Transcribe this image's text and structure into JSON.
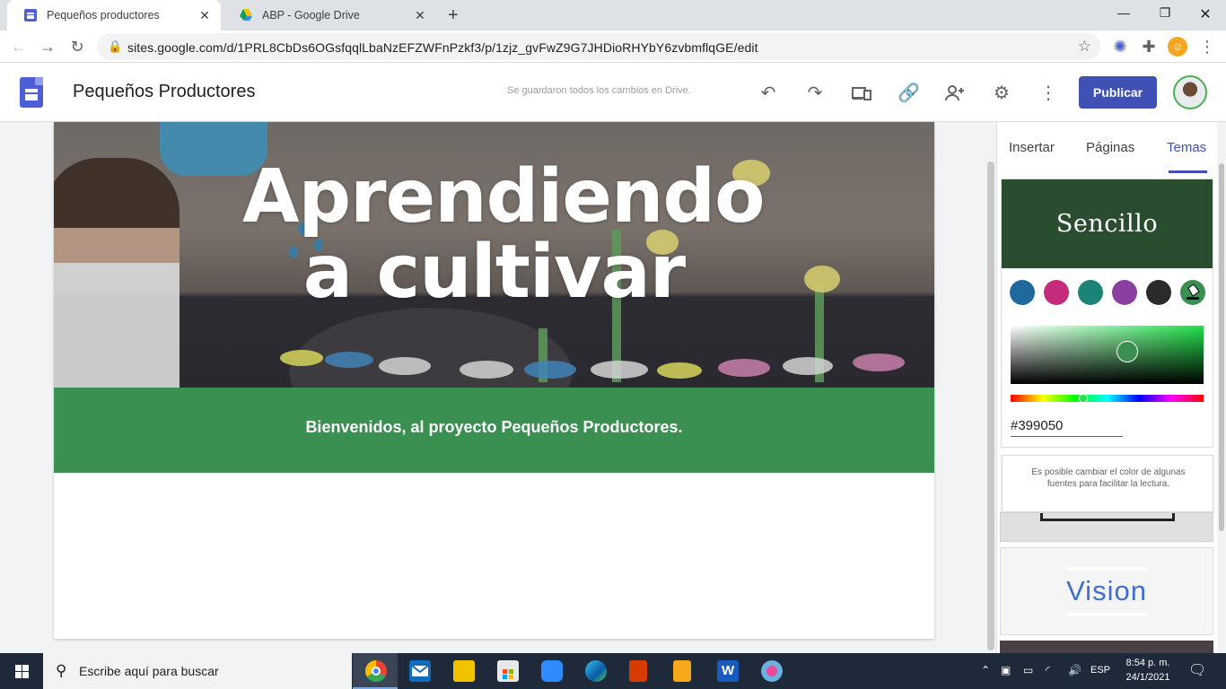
{
  "browser": {
    "tabs": [
      {
        "title": "Pequeños productores",
        "active": true
      },
      {
        "title": "ABP - Google Drive",
        "active": false
      }
    ],
    "url": "sites.google.com/d/1PRL8CbDs6OGsfqqlLbaNzEFZWFnPzkf3/p/1zjz_gvFwZ9G7JHDioRHYbY6zvbmflqGE/edit"
  },
  "sites": {
    "site_title": "Pequeños Productores",
    "save_status": "Se guardaron todos los cambios en Drive.",
    "publish_label": "Publicar"
  },
  "page": {
    "hero_title": "Aprendiendo a cultivar",
    "banner_text": "Bienvenidos, al proyecto Pequeños Productores."
  },
  "panel": {
    "tabs": [
      "Insertar",
      "Páginas",
      "Temas"
    ],
    "active_tab": "Temas",
    "theme_name": "Sencillo",
    "theme_colors": [
      "#1f6a9c",
      "#c42b7a",
      "#1b8476",
      "#8b3fa0",
      "#2b2b2b",
      "#399050"
    ],
    "hex_value": "#399050",
    "tip": "Es posible cambiar el color de algunas fuentes para facilitar la lectura.",
    "next_theme": "Vision"
  },
  "taskbar": {
    "search_placeholder": "Escribe aquí para buscar",
    "lang": "ESP",
    "time": "8:54 p. m.",
    "date": "24/1/2021"
  }
}
